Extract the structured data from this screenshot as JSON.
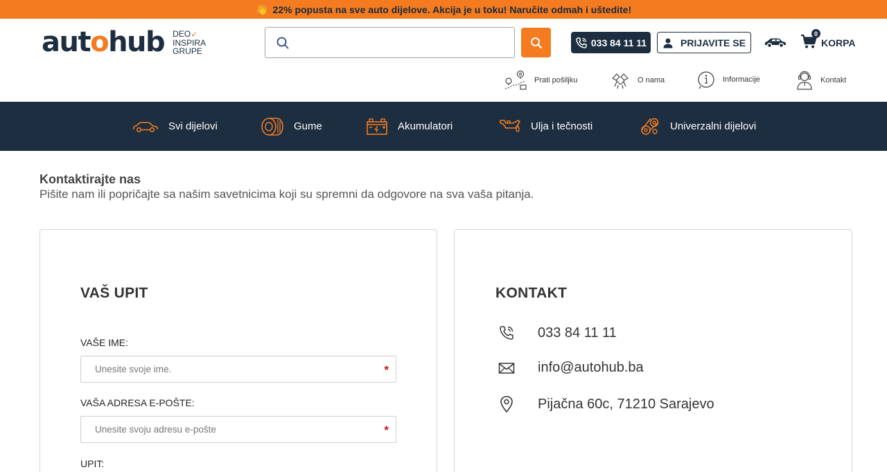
{
  "promo": {
    "text": "22% popusta na sve auto dijelove. Akcija je u toku! Naručite odmah i uštedite!",
    "icon": "waving-hand-icon",
    "bg_color": "#f47b20"
  },
  "header": {
    "logo": {
      "part1": "aut",
      "part2": "o",
      "part3": "hub",
      "sub_line1": "DEO",
      "sub_line2": "INSPIRA",
      "sub_line3": "GRUPE"
    },
    "search": {
      "placeholder": ""
    },
    "phone": "033 84 11 11",
    "login_label": "PRIJAVITE SE",
    "cart": {
      "label": "KORPA",
      "count": "0"
    },
    "utility_links": [
      {
        "label": "Prati pošiljku",
        "icon": "tracking-icon"
      },
      {
        "label": "O nama",
        "icon": "handshake-icon"
      },
      {
        "label": "Informacije",
        "icon": "info-icon"
      },
      {
        "label": "Kontakt",
        "icon": "support-agent-icon"
      }
    ]
  },
  "nav": {
    "bg_color": "#1c2e40",
    "items": [
      {
        "label": "Svi dijelovi",
        "icon": "car-icon"
      },
      {
        "label": "Gume",
        "icon": "tire-icon"
      },
      {
        "label": "Akumulatori",
        "icon": "battery-icon"
      },
      {
        "label": "Ulja i tečnosti",
        "icon": "oil-can-icon"
      },
      {
        "label": "Univerzalni dijelovi",
        "icon": "belt-icon"
      }
    ]
  },
  "intro": {
    "title": "Kontaktirajte nas",
    "subtitle": "Pišite nam ili popričajte sa našim savetnicima koji su spremni da odgovore na sva vaša pitanja."
  },
  "form": {
    "title": "VAŠ UPIT",
    "name_label": "VAŠE IME:",
    "name_placeholder": "Unesite svoje ime.",
    "email_label": "VAŠA ADRESA E-POŠTE:",
    "email_placeholder": "Unesite svoju adresu e-pošte",
    "query_label": "UPIT:",
    "required_mark": "*"
  },
  "contact": {
    "title": "KONTAKT",
    "phone": "033 84 11 11",
    "email": "info@autohub.ba",
    "address": "Pijačna 60c, 71210 Sarajevo"
  }
}
